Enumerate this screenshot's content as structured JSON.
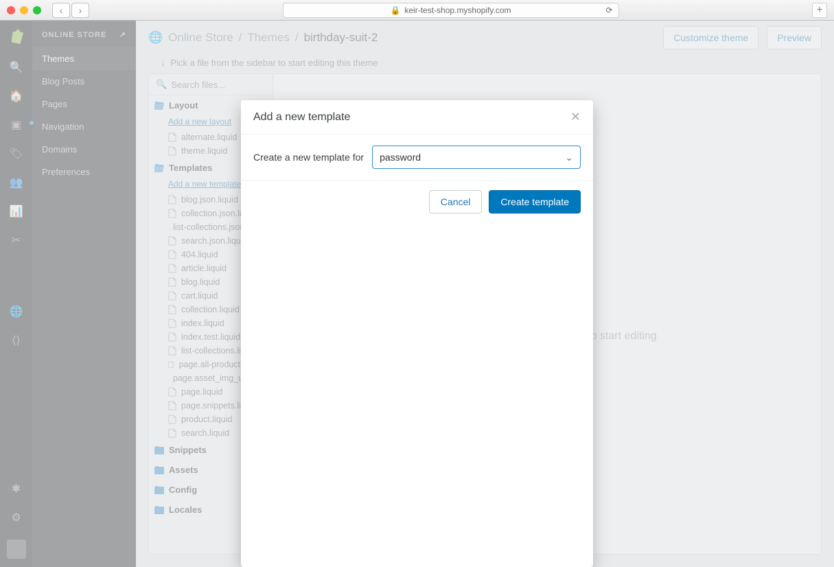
{
  "browser": {
    "url": "keir-test-shop.myshopify.com"
  },
  "subnav": {
    "title": "ONLINE STORE",
    "items": [
      "Themes",
      "Blog Posts",
      "Pages",
      "Navigation",
      "Domains",
      "Preferences"
    ],
    "active": 0
  },
  "breadcrumb": {
    "a": "Online Store",
    "b": "Themes",
    "current": "birthday-suit-2"
  },
  "actions": {
    "customize": "Customize theme",
    "preview": "Preview"
  },
  "hint": "Pick a file from the sidebar to start editing this theme",
  "editor_placeholder": "Pick a file from the left sidebar to start editing",
  "files": {
    "search_placeholder": "Search files...",
    "layout": {
      "label": "Layout",
      "add": "Add a new layout",
      "items": [
        "alternate.liquid",
        "theme.liquid"
      ]
    },
    "templates": {
      "label": "Templates",
      "add": "Add a new template",
      "items": [
        "blog.json.liquid",
        "collection.json.liquid",
        "list-collections.json.liquid",
        "search.json.liquid",
        "404.liquid",
        "article.liquid",
        "blog.liquid",
        "cart.liquid",
        "collection.liquid",
        "index.liquid",
        "index.test.liquid",
        "list-collections.liquid",
        "page.all-products.liquid",
        "page.asset_img_url.liquid",
        "page.liquid",
        "page.snippets.liquid",
        "product.liquid",
        "search.liquid"
      ]
    },
    "snippets": {
      "label": "Snippets"
    },
    "assets": {
      "label": "Assets"
    },
    "config": {
      "label": "Config"
    },
    "locales": {
      "label": "Locales"
    }
  },
  "modal": {
    "title": "Add a new template",
    "label": "Create a new template for",
    "selected": "password",
    "cancel": "Cancel",
    "create": "Create template"
  }
}
